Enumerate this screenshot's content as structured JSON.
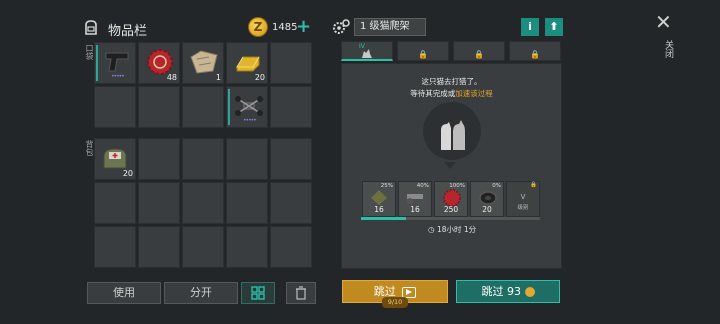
{
  "inventory": {
    "title": "物品栏",
    "coins": "1485",
    "coin_symbol": "Z",
    "plus": "+",
    "pocket_label": "口袋",
    "backpack_label": "背包",
    "items": {
      "pistol_dots": "•••••",
      "bottlecap_qty": "48",
      "map_qty": "1",
      "gold_qty": "20",
      "drone_dots": "•••••",
      "bag_qty": "20"
    },
    "buttons": {
      "use": "使用",
      "split": "分开"
    }
  },
  "panel": {
    "title": "1 级猫爬架",
    "info": "i",
    "upload": "⬆",
    "tab_level": "IV",
    "lock": "🔒",
    "message_line1": "这只猫去打猎了。",
    "message_line2_prefix": "等待其完成或",
    "message_link": "加速该过程",
    "resources": [
      {
        "pct": "25%",
        "num": "16"
      },
      {
        "pct": "40%",
        "num": "16"
      },
      {
        "pct": "100%",
        "num": "250"
      },
      {
        "pct": "0%",
        "num": "20"
      }
    ],
    "level_slot": {
      "roman": "V",
      "label": "级别"
    },
    "progress_fraction": 0.25,
    "timer": "18小时 1分",
    "skip_gold": "跳过",
    "skip_gold_badge": "9/10",
    "skip_teal": "跳过",
    "skip_teal_cost": "93"
  },
  "close": {
    "x": "✕",
    "label": "关闭"
  },
  "colors": {
    "accent": "#2bc0a8",
    "gold": "#c08a20",
    "link": "#e3a52f"
  }
}
